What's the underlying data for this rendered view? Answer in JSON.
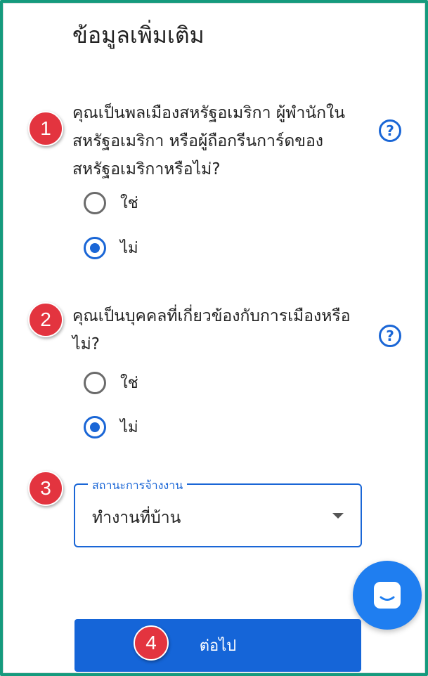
{
  "page": {
    "title": "ข้อมูลเพิ่มเติม"
  },
  "questions": [
    {
      "text": "คุณเป็นพลเมืองสหรัฐอเมริกา ผู้พำนักในสหรัฐอเมริกา หรือผู้ถือกรีนการ์ดของสหรัฐอเมริกาหรือไม่?",
      "options": [
        {
          "label": "ใช่",
          "selected": false
        },
        {
          "label": "ไม่",
          "selected": true
        }
      ]
    },
    {
      "text": "คุณเป็นบุคคลที่เกี่ยวข้องกับการเมืองหรือไม่?",
      "options": [
        {
          "label": "ใช่",
          "selected": false
        },
        {
          "label": "ไม่",
          "selected": true
        }
      ]
    }
  ],
  "employment": {
    "label": "สถานะการจ้างงาน",
    "value": "ทำงานที่บ้าน"
  },
  "help_icon": "?",
  "next_button": {
    "label": "ต่อไป"
  },
  "steps": [
    "1",
    "2",
    "3",
    "4"
  ],
  "colors": {
    "accent": "#1a66d6",
    "button": "#1565d8",
    "chat": "#1f7ef0",
    "step_badge": "#e3343f",
    "frame": "#159a7d"
  }
}
